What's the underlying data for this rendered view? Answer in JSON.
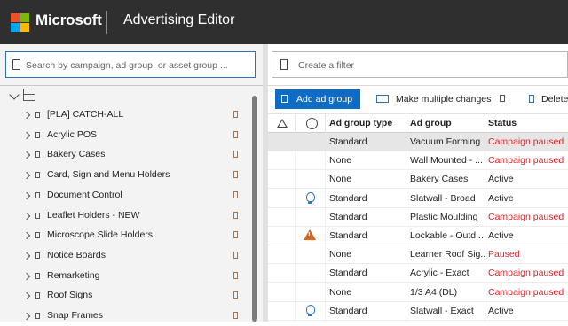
{
  "header": {
    "brand": "Microsoft",
    "app_title": "Advertising Editor"
  },
  "left_pane": {
    "search_placeholder": "Search by campaign, ad group, or asset group ...",
    "tree": {
      "items": [
        {
          "label": "[PLA] CATCH-ALL"
        },
        {
          "label": "Acrylic POS"
        },
        {
          "label": "Bakery Cases"
        },
        {
          "label": "Card, Sign and Menu Holders"
        },
        {
          "label": "Document Control"
        },
        {
          "label": "Leaflet Holders - NEW"
        },
        {
          "label": "Microscope Slide Holders"
        },
        {
          "label": "Notice Boards"
        },
        {
          "label": "Remarketing"
        },
        {
          "label": "Roof Signs"
        },
        {
          "label": "Snap Frames"
        }
      ]
    }
  },
  "right_pane": {
    "filter_placeholder": "Create a filter",
    "toolbar": {
      "add_label": "Add ad group",
      "multi_label": "Make multiple changes",
      "delete_label": "Delete"
    },
    "grid": {
      "columns": {
        "type": "Ad group type",
        "name": "Ad group",
        "status": "Status"
      },
      "rows": [
        {
          "type": "Standard",
          "name": "Vacuum Forming",
          "status": "Campaign paused",
          "icon": ""
        },
        {
          "type": "None",
          "name": "Wall Mounted - ...",
          "status": "Campaign paused",
          "icon": ""
        },
        {
          "type": "None",
          "name": "Bakery Cases",
          "status": "Active",
          "icon": ""
        },
        {
          "type": "Standard",
          "name": "Slatwall - Broad",
          "status": "Active",
          "icon": "lightbulb-icon"
        },
        {
          "type": "Standard",
          "name": "Plastic Moulding",
          "status": "Campaign paused",
          "icon": ""
        },
        {
          "type": "Standard",
          "name": "Lockable - Outd...",
          "status": "Active",
          "icon": "warning-icon"
        },
        {
          "type": "None",
          "name": "Learner Roof Sig...",
          "status": "Paused",
          "icon": ""
        },
        {
          "type": "Standard",
          "name": "Acrylic - Exact",
          "status": "Campaign paused",
          "icon": ""
        },
        {
          "type": "None",
          "name": "1/3 A4 (DL)",
          "status": "Campaign paused",
          "icon": ""
        },
        {
          "type": "Standard",
          "name": "Slatwall - Exact",
          "status": "Active",
          "icon": "lightbulb-icon"
        }
      ]
    }
  },
  "colors": {
    "header_bg": "#2f2f2f",
    "accent": "#0e6cc4",
    "paused": "#d8262b",
    "logo": [
      "#f25022",
      "#7fba00",
      "#00a4ef",
      "#ffb900"
    ]
  }
}
